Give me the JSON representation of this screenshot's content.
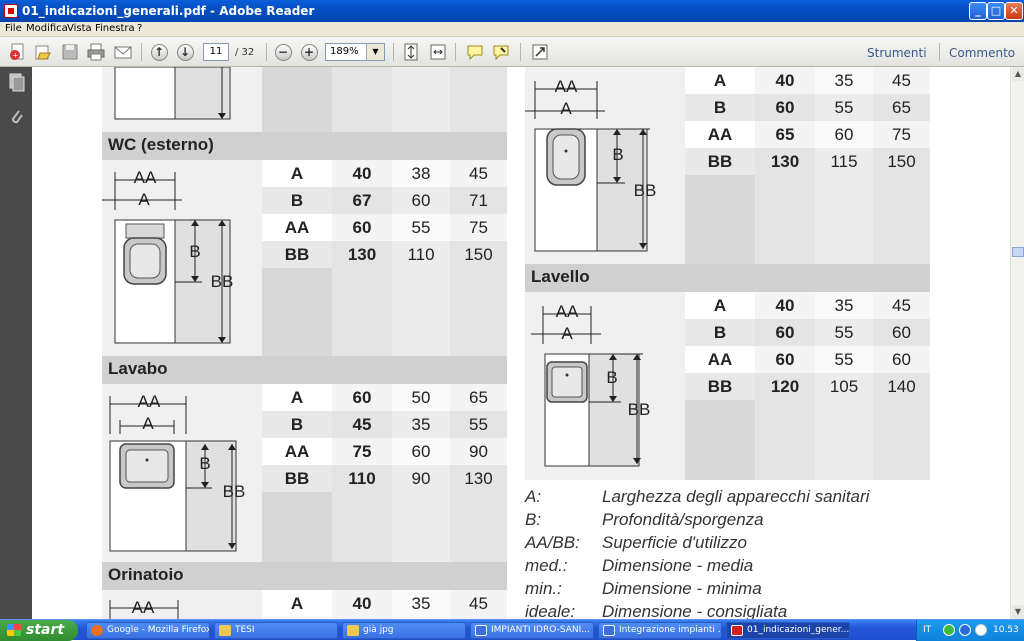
{
  "window": {
    "title": "01_indicazioni_generali.pdf - Adobe Reader",
    "min_label": "_",
    "max_label": "□",
    "close_label": "✕"
  },
  "menu": [
    "File",
    "Modifica",
    "Vista",
    "Finestra",
    "?"
  ],
  "toolbar": {
    "page_current": "11",
    "page_total": "/ 32",
    "zoom": "189%",
    "tools_label": "Strumenti",
    "comment_label": "Commento"
  },
  "left_column": {
    "sections": [
      {
        "title": "WC (esterno)",
        "labels": [
          "AA",
          "A",
          "B",
          "BB"
        ],
        "rows": [
          {
            "key": "A",
            "med": "40",
            "min": "38",
            "ideal": "45"
          },
          {
            "key": "B",
            "med": "67",
            "min": "60",
            "ideal": "71"
          },
          {
            "key": "AA",
            "med": "60",
            "min": "55",
            "ideal": "75"
          },
          {
            "key": "BB",
            "med": "130",
            "min": "110",
            "ideal": "150"
          }
        ]
      },
      {
        "title": "Lavabo",
        "labels": [
          "AA",
          "A",
          "B",
          "BB"
        ],
        "rows": [
          {
            "key": "A",
            "med": "60",
            "min": "50",
            "ideal": "65"
          },
          {
            "key": "B",
            "med": "45",
            "min": "35",
            "ideal": "55"
          },
          {
            "key": "AA",
            "med": "75",
            "min": "60",
            "ideal": "90"
          },
          {
            "key": "BB",
            "med": "110",
            "min": "90",
            "ideal": "130"
          }
        ]
      },
      {
        "title": "Orinatoio",
        "labels": [
          "AA"
        ],
        "rows": [
          {
            "key": "A",
            "med": "40",
            "min": "35",
            "ideal": "45"
          }
        ]
      }
    ]
  },
  "right_column": {
    "top_section": {
      "labels": [
        "AA",
        "A",
        "B",
        "BB"
      ],
      "rows": [
        {
          "key": "A",
          "med": "40",
          "min": "35",
          "ideal": "45"
        },
        {
          "key": "B",
          "med": "60",
          "min": "55",
          "ideal": "65"
        },
        {
          "key": "AA",
          "med": "65",
          "min": "60",
          "ideal": "75"
        },
        {
          "key": "BB",
          "med": "130",
          "min": "115",
          "ideal": "150"
        }
      ]
    },
    "sink_section": {
      "title": "Lavello",
      "labels": [
        "AA",
        "A",
        "B",
        "BB"
      ],
      "rows": [
        {
          "key": "A",
          "med": "40",
          "min": "35",
          "ideal": "45"
        },
        {
          "key": "B",
          "med": "60",
          "min": "55",
          "ideal": "60"
        },
        {
          "key": "AA",
          "med": "60",
          "min": "55",
          "ideal": "60"
        },
        {
          "key": "BB",
          "med": "120",
          "min": "105",
          "ideal": "140"
        }
      ]
    },
    "legend": [
      {
        "term": "A:",
        "desc": "Larghezza degli apparecchi sanitari"
      },
      {
        "term": "B:",
        "desc": "Profondità/sporgenza"
      },
      {
        "term": "AA/BB:",
        "desc": "Superficie d'utilizzo"
      },
      {
        "term": "med.:",
        "desc": "Dimensione - media"
      },
      {
        "term": "min.:",
        "desc": "Dimensione - minima"
      },
      {
        "term": "ideale:",
        "desc": "Dimensione - consigliata"
      }
    ]
  },
  "taskbar": {
    "start_label": "start",
    "tasks": [
      {
        "label": "Google - Mozilla Firefox",
        "color": "#e8701a"
      },
      {
        "label": "TESI",
        "color": "#f0c850"
      },
      {
        "label": "già jpg",
        "color": "#f0c850"
      },
      {
        "label": "IMPIANTI IDRO-SANI...",
        "color": "#3a6fd8"
      },
      {
        "label": "Integrazione impianti ...",
        "color": "#3a6fd8"
      },
      {
        "label": "01_indicazioni_gener...",
        "color": "#d02020"
      }
    ],
    "lang": "IT",
    "clock": "10.53"
  }
}
